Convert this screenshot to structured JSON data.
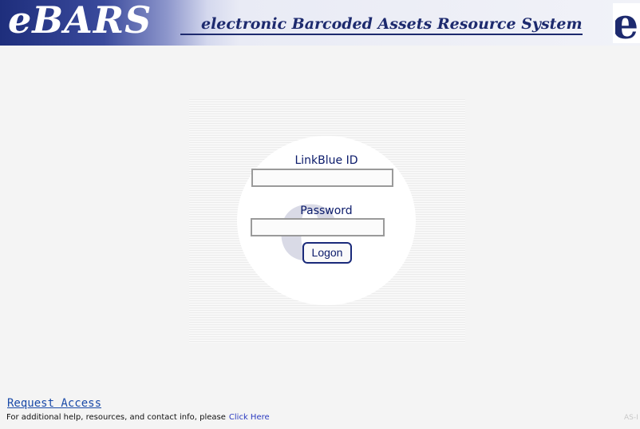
{
  "header": {
    "logo_text": "eBARS",
    "tagline": "electronic Barcoded Assets Resource System"
  },
  "login": {
    "username_label": "LinkBlue ID",
    "username_value": "",
    "password_label": "Password",
    "password_value": "",
    "logon_label": "Logon"
  },
  "footer": {
    "request_access": "Request Access",
    "help_text": "For additional help, resources, and contact info, please",
    "help_link": "Click Here",
    "version_tag": "AS-I"
  },
  "colors": {
    "brand_navy": "#1d2a6e",
    "link_blue": "#1a4aa8"
  }
}
